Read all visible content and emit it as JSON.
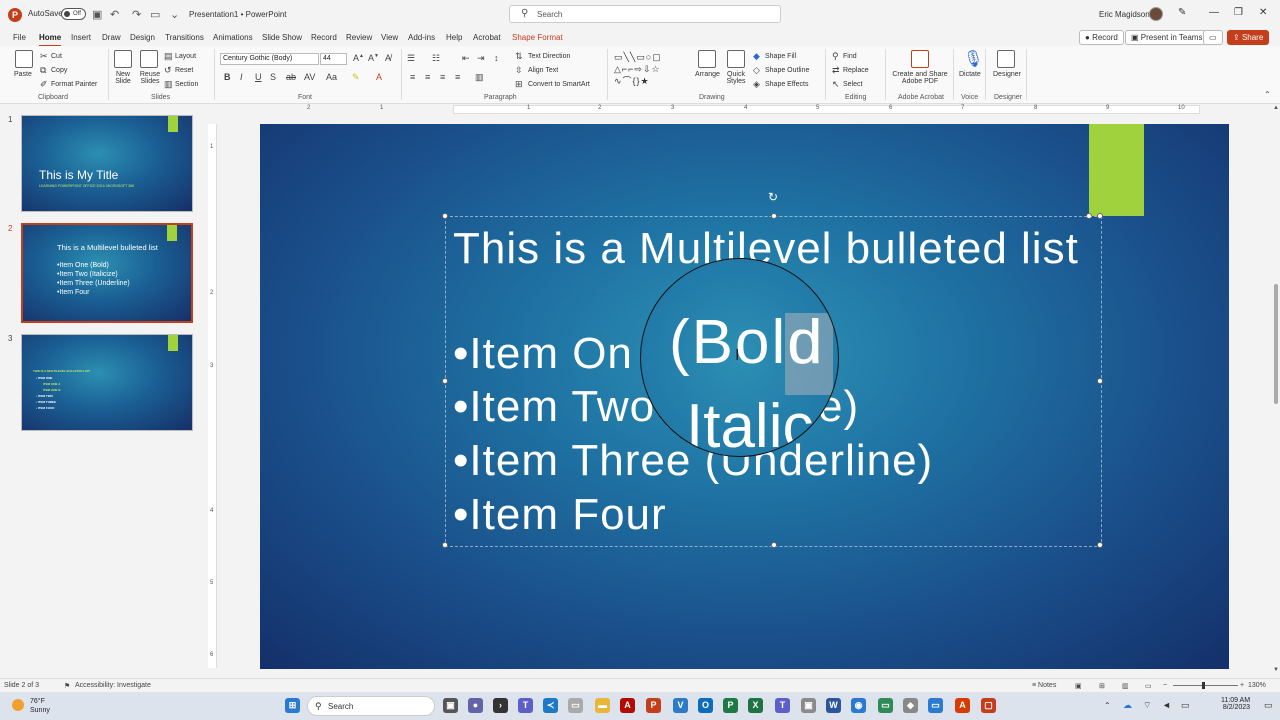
{
  "app": {
    "autosave": "AutoSave",
    "toggle": "Off",
    "doc_title": "Presentation1 • PowerPoint",
    "search_placeholder": "Search",
    "user": "Eric Magidson"
  },
  "menu": {
    "tabs": [
      "File",
      "Home",
      "Insert",
      "Draw",
      "Design",
      "Transitions",
      "Animations",
      "Slide Show",
      "Record",
      "Review",
      "View",
      "Add-ins",
      "Help",
      "Acrobat",
      "Shape Format"
    ],
    "active": "Home",
    "record": "Record",
    "present": "Present in Teams",
    "share": "Share"
  },
  "ribbon": {
    "clipboard": {
      "paste": "Paste",
      "cut": "Cut",
      "copy": "Copy",
      "format_painter": "Format Painter",
      "label": "Clipboard"
    },
    "slides": {
      "new_slide": "New Slide",
      "reuse": "Reuse Slides",
      "layout": "Layout",
      "reset": "Reset",
      "section": "Section",
      "label": "Slides"
    },
    "font": {
      "name": "Century Gothic (Body)",
      "size": "44",
      "label": "Font"
    },
    "paragraph": {
      "text_direction": "Text Direction",
      "align_text": "Align Text",
      "convert": "Convert to SmartArt",
      "label": "Paragraph"
    },
    "drawing": {
      "arrange": "Arrange",
      "quick_styles": "Quick Styles",
      "fill": "Shape Fill",
      "outline": "Shape Outline",
      "effects": "Shape Effects",
      "label": "Drawing"
    },
    "editing": {
      "find": "Find",
      "replace": "Replace",
      "select": "Select",
      "label": "Editing"
    },
    "adobe": {
      "create": "Create and Share Adobe PDF",
      "label": "Adobe Acrobat"
    },
    "voice": {
      "dictate": "Dictate",
      "label": "Voice"
    },
    "designer": {
      "designer": "Designer",
      "label": "Designer"
    }
  },
  "thumbnails": [
    {
      "num": "1",
      "title": "This is My Title",
      "subtitle": "LEARNING POWERPOINT OFFICE 2021/ MICROSOFT 365"
    },
    {
      "num": "2",
      "title": "This is a Multilevel bulleted list",
      "items": [
        "•Item One (Bold)",
        "•Item Two (Italicize)",
        "•Item Three (Underline)",
        "•Item Four"
      ]
    },
    {
      "num": "3",
      "title": "THIS IS A MULTILEVEL BULLETED LIST",
      "items": [
        "• ITEM ONE",
        "ITEM ONE A",
        "ITEM ONE B",
        "• ITEM TWO",
        "• ITEM THREE",
        "• ITEM FOUR"
      ]
    }
  ],
  "ruler": {
    "h": [
      "2",
      "1",
      "",
      "1",
      "2",
      "3",
      "4",
      "5",
      "6",
      "7",
      "8",
      "9",
      "10"
    ],
    "v": [
      "1",
      "2",
      "3",
      "4",
      "5",
      "6"
    ]
  },
  "slide": {
    "title": "This is a Multilevel bulleted list",
    "bullets": [
      "•Item On",
      "•Item Two",
      "•Item Three (Underline)",
      "•Item Four"
    ],
    "magnified": "(Bold",
    "magnified_d": "d",
    "magnified2": "Italic",
    "peek_e": "e)"
  },
  "status": {
    "slide": "Slide 2 of 3",
    "accessibility": "Accessibility: Investigate",
    "notes": "Notes",
    "zoom": "130%"
  },
  "taskbar": {
    "temp": "76°F",
    "weather": "Sunny",
    "search": "Search",
    "time": "11:09 AM",
    "date": "8/2/2023"
  }
}
